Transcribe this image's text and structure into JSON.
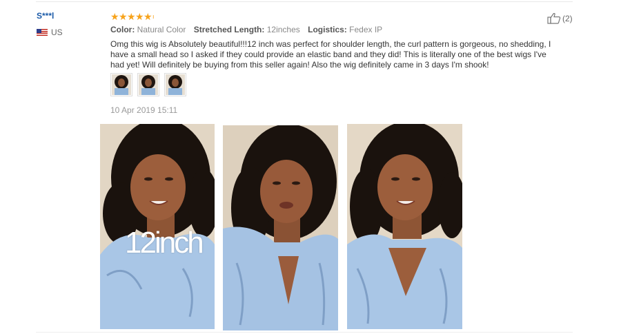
{
  "reviewer": {
    "name": "S***l",
    "country": "US"
  },
  "rating": {
    "stars": 5,
    "max": 5
  },
  "attributes": [
    {
      "label": "Color:",
      "value": "Natural Color"
    },
    {
      "label": "Stretched Length:",
      "value": "12inches"
    },
    {
      "label": "Logistics:",
      "value": "Fedex IP"
    }
  ],
  "review_text": "Omg this wig is Absolutely beautiful!!!12 inch was perfect for shoulder length, the curl pattern is gorgeous, no shedding, I have a small head so I asked if they could provide an elastic band and they did! This is literally one of the best wigs I've had yet! Will definitely be buying from this seller again! Also the wig definitely came in 3 days I'm shook!",
  "date": "10 Apr 2019 15:11",
  "helpful": {
    "count_label": "(2)"
  },
  "photos": [
    {
      "caption": "12inch"
    },
    {
      "caption": ""
    },
    {
      "caption": ""
    }
  ],
  "colors": {
    "link": "#1a5aa8",
    "star": "#f7a31c",
    "muted": "#999999"
  }
}
